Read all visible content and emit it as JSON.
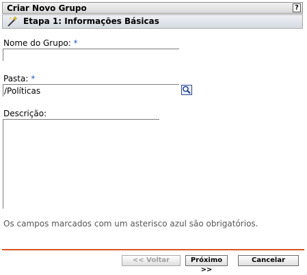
{
  "dialog": {
    "title": "Criar Novo Grupo",
    "help_label": "?"
  },
  "step": {
    "title": "Etapa 1: Informações Básicas",
    "icon": "wand-icon"
  },
  "form": {
    "group_name": {
      "label": "Nome do Grupo:",
      "required_mark": "*",
      "value": ""
    },
    "folder": {
      "label": "Pasta:",
      "required_mark": "*",
      "value": "/Políticas",
      "browse_icon": "magnifier-icon"
    },
    "description": {
      "label": "Descrição:",
      "value": ""
    }
  },
  "required_note": "Os campos marcados com um asterisco azul são obrigatórios.",
  "buttons": {
    "back": "<< Voltar",
    "next": "Próximo >>",
    "cancel": "Cancelar"
  },
  "colors": {
    "required_asterisk": "#2457c7",
    "divider": "#d9531e"
  }
}
